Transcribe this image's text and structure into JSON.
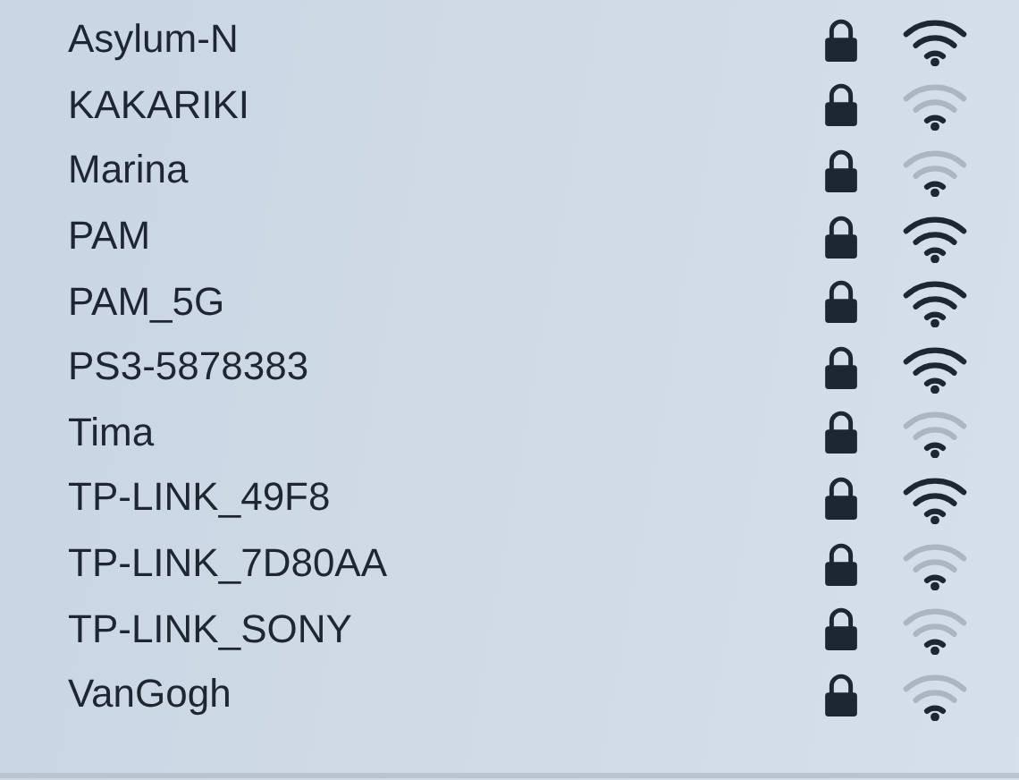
{
  "networks": [
    {
      "name": "Asylum-N",
      "locked": true,
      "strong_signal": true
    },
    {
      "name": "KAKARIKI",
      "locked": true,
      "strong_signal": false
    },
    {
      "name": "Marina",
      "locked": true,
      "strong_signal": false
    },
    {
      "name": "PAM",
      "locked": true,
      "strong_signal": true
    },
    {
      "name": "PAM_5G",
      "locked": true,
      "strong_signal": true
    },
    {
      "name": "PS3-5878383",
      "locked": true,
      "strong_signal": true
    },
    {
      "name": "Tima",
      "locked": true,
      "strong_signal": false
    },
    {
      "name": "TP-LINK_49F8",
      "locked": true,
      "strong_signal": true
    },
    {
      "name": "TP-LINK_7D80AA",
      "locked": true,
      "strong_signal": false
    },
    {
      "name": "TP-LINK_SONY",
      "locked": true,
      "strong_signal": false
    },
    {
      "name": "VanGogh",
      "locked": true,
      "strong_signal": false
    }
  ]
}
